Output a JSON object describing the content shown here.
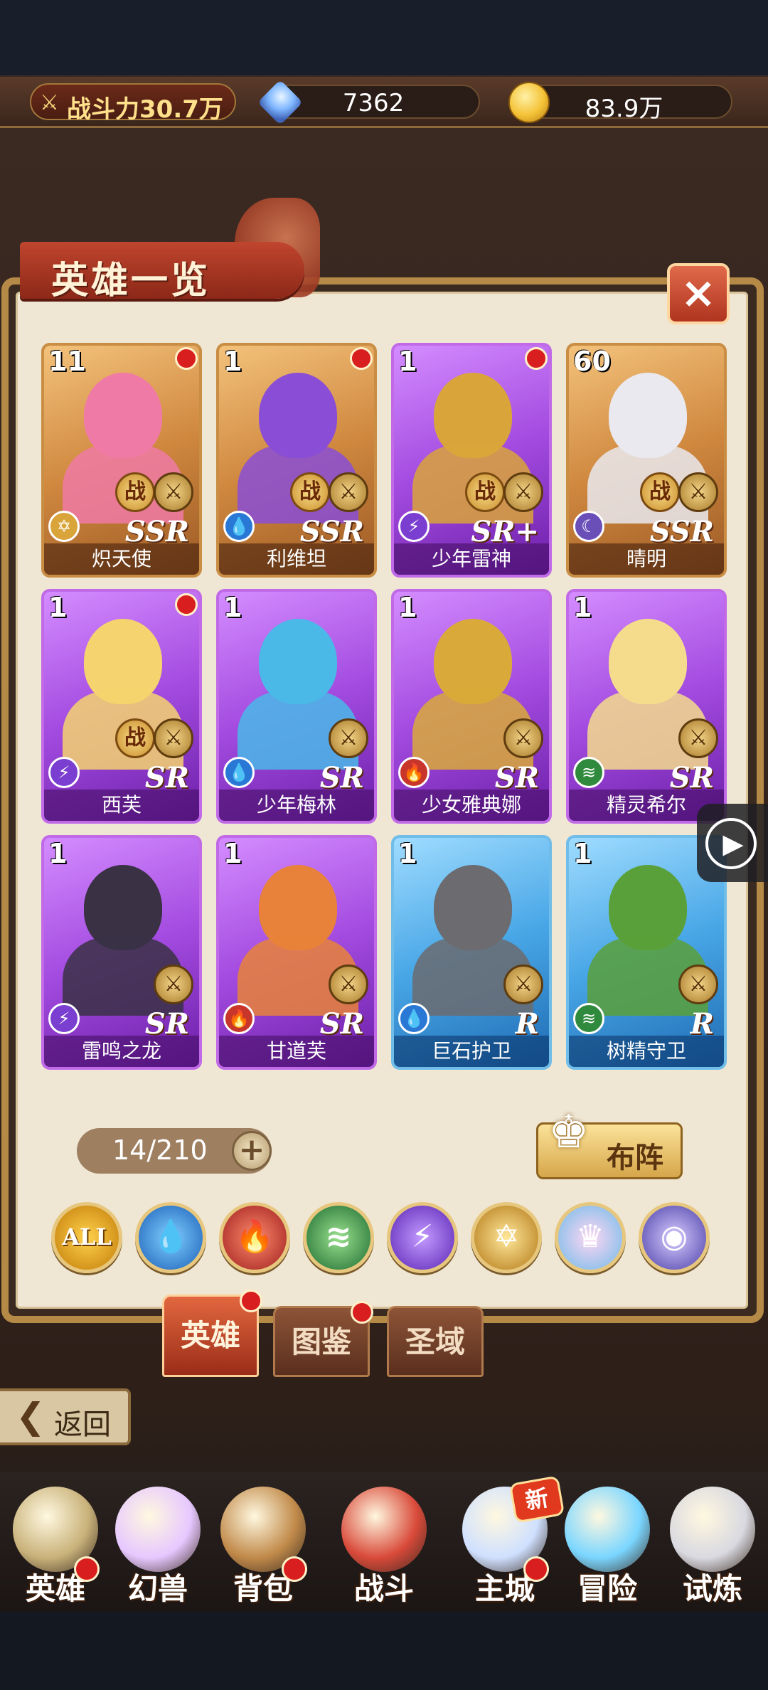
{
  "topbar": {
    "power_label": "战斗力30.7万",
    "gems": "7362",
    "gold": "83.9万"
  },
  "panel": {
    "title": "英雄一览",
    "close_icon": "×"
  },
  "heroes": [
    {
      "level": "11",
      "name": "炽天使",
      "rank": "SSR",
      "frame": "gold",
      "element": "star-icon",
      "has_zhan": true,
      "dot": true,
      "art_color": "#f07aa6"
    },
    {
      "level": "1",
      "name": "利维坦",
      "rank": "SSR",
      "frame": "gold",
      "element": "water-icon",
      "has_zhan": true,
      "dot": true,
      "art_color": "#8a4dd6"
    },
    {
      "level": "1",
      "name": "少年雷神",
      "rank": "SR+",
      "frame": "purple",
      "element": "lightning-icon",
      "has_zhan": true,
      "dot": true,
      "art_color": "#d9a53a"
    },
    {
      "level": "60",
      "name": "晴明",
      "rank": "SSR",
      "frame": "gold",
      "element": "moon-icon",
      "has_zhan": true,
      "dot": false,
      "art_color": "#e9e9ef"
    },
    {
      "level": "1",
      "name": "西芙",
      "rank": "SR",
      "frame": "purple",
      "element": "lightning-icon",
      "has_zhan": true,
      "dot": true,
      "art_color": "#f5d36e"
    },
    {
      "level": "1",
      "name": "少年梅林",
      "rank": "SR",
      "frame": "purple",
      "element": "water-icon",
      "has_zhan": false,
      "dot": false,
      "art_color": "#4ab9e8"
    },
    {
      "level": "1",
      "name": "少女雅典娜",
      "rank": "SR",
      "frame": "purple",
      "element": "fire-icon",
      "has_zhan": false,
      "dot": false,
      "art_color": "#d9aa3a"
    },
    {
      "level": "1",
      "name": "精灵希尔",
      "rank": "SR",
      "frame": "purple",
      "element": "wind-icon",
      "has_zhan": false,
      "dot": false,
      "art_color": "#f4dc8c"
    },
    {
      "level": "1",
      "name": "雷鸣之龙",
      "rank": "SR",
      "frame": "purple",
      "element": "lightning-icon",
      "has_zhan": false,
      "dot": false,
      "art_color": "#3a3145"
    },
    {
      "level": "1",
      "name": "甘道芙",
      "rank": "SR",
      "frame": "purple",
      "element": "fire-icon",
      "has_zhan": false,
      "dot": false,
      "art_color": "#e8823a"
    },
    {
      "level": "1",
      "name": "巨石护卫",
      "rank": "R",
      "frame": "blue",
      "element": "water-icon",
      "has_zhan": false,
      "dot": false,
      "art_color": "#6b6b70"
    },
    {
      "level": "1",
      "name": "树精守卫",
      "rank": "R",
      "frame": "blue",
      "element": "wind-icon",
      "has_zhan": false,
      "dot": false,
      "art_color": "#5aa03a"
    }
  ],
  "footer": {
    "hero_count": "14/210",
    "formation_label": "布阵"
  },
  "filters": [
    {
      "name": "all",
      "label": "ALL"
    },
    {
      "name": "water",
      "label": "💧"
    },
    {
      "name": "fire",
      "label": "🔥"
    },
    {
      "name": "wind",
      "label": "≋"
    },
    {
      "name": "light",
      "label": "⚡"
    },
    {
      "name": "star",
      "label": "✡"
    },
    {
      "name": "crown",
      "label": "♛"
    },
    {
      "name": "eye",
      "label": "◉"
    }
  ],
  "tabs": [
    {
      "label": "英雄",
      "active": true
    },
    {
      "label": "图鉴",
      "active": false
    },
    {
      "label": "圣域",
      "active": false
    }
  ],
  "back_label": "返回",
  "nav": [
    {
      "label": "英雄",
      "dot": true,
      "color": "#c9b27a"
    },
    {
      "label": "幻兽",
      "dot": false,
      "color": "#e6c8ff"
    },
    {
      "label": "背包",
      "dot": true,
      "color": "#c18a4a"
    },
    {
      "label": "战斗",
      "dot": false,
      "color": "#d94a3a"
    },
    {
      "label": "主城",
      "dot": true,
      "color": "#cfe0ff"
    },
    {
      "label": "冒险",
      "dot": false,
      "color": "#7ad6ff"
    },
    {
      "label": "试炼",
      "dot": false,
      "color": "#d9d9e0"
    }
  ],
  "new_badge": "新",
  "colors": {
    "accent_red": "#d81e1e",
    "panel_bg": "#efe6d4",
    "gold_frame": "#c98d44"
  }
}
